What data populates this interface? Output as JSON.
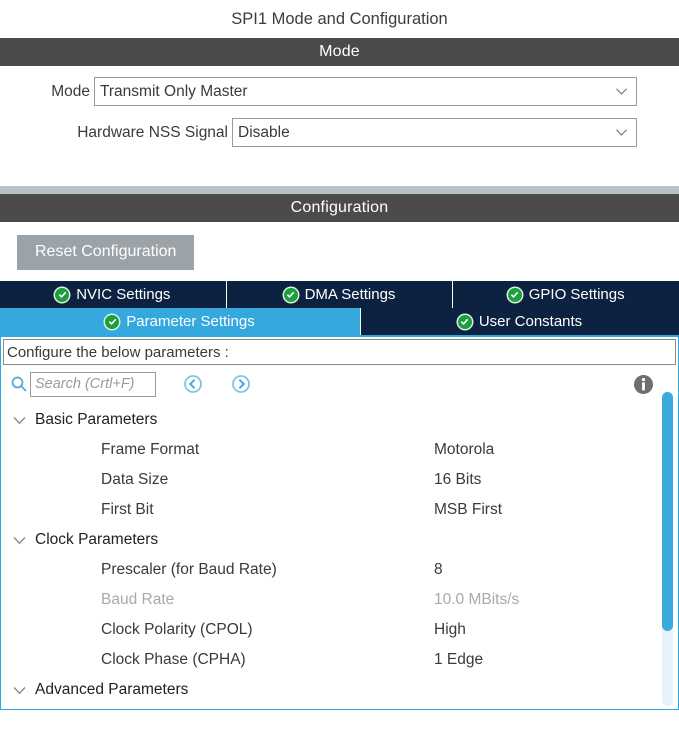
{
  "header": {
    "title": "SPI1 Mode and Configuration"
  },
  "mode_section": {
    "bar_title": "Mode",
    "fields": [
      {
        "label": "Mode",
        "value": "Transmit Only Master",
        "icon": "chevron-down-icon"
      },
      {
        "label": "Hardware NSS Signal",
        "value": "Disable",
        "icon": "chevron-down-icon"
      }
    ]
  },
  "configuration_section": {
    "bar_title": "Configuration",
    "reset_button": "Reset Configuration",
    "tabs_row1": [
      {
        "label": "NVIC Settings",
        "active": false
      },
      {
        "label": "DMA Settings",
        "active": false
      },
      {
        "label": "GPIO Settings",
        "active": false
      }
    ],
    "tabs_row2": [
      {
        "label": "Parameter Settings",
        "active": true
      },
      {
        "label": "User Constants",
        "active": false
      }
    ]
  },
  "param_panel": {
    "configure_text": "Configure the below parameters :",
    "search": {
      "placeholder": "Search (Crtl+F)",
      "value": "",
      "icon": "search-icon"
    },
    "nav_back_icon": "circle-arrow-left-icon",
    "nav_forward_icon": "circle-arrow-right-icon",
    "info_icon": "info-icon",
    "groups": [
      {
        "name": "Basic Parameters",
        "expanded": true,
        "items": [
          {
            "name": "Frame Format",
            "value": "Motorola",
            "disabled": false
          },
          {
            "name": "Data Size",
            "value": "16 Bits",
            "disabled": false
          },
          {
            "name": "First Bit",
            "value": "MSB First",
            "disabled": false
          }
        ]
      },
      {
        "name": "Clock Parameters",
        "expanded": true,
        "items": [
          {
            "name": "Prescaler (for Baud Rate)",
            "value": "8",
            "disabled": false
          },
          {
            "name": "Baud Rate",
            "value": "10.0 MBits/s",
            "disabled": true
          },
          {
            "name": "Clock Polarity (CPOL)",
            "value": "High",
            "disabled": false
          },
          {
            "name": "Clock Phase (CPHA)",
            "value": "1 Edge",
            "disabled": false
          }
        ]
      },
      {
        "name": "Advanced Parameters",
        "expanded": true,
        "items": []
      }
    ],
    "scrollbar": {
      "name": "vertical-scrollbar"
    }
  },
  "colors": {
    "section_bar": "#4b4b4b",
    "tab_inactive": "#0d2240",
    "tab_active": "#35a8dd",
    "accent_blue": "#2aa8e0",
    "reset_button": "#9ba2a8",
    "check_green": "#1f9e3f",
    "separator_band": "#b4c2c9"
  }
}
